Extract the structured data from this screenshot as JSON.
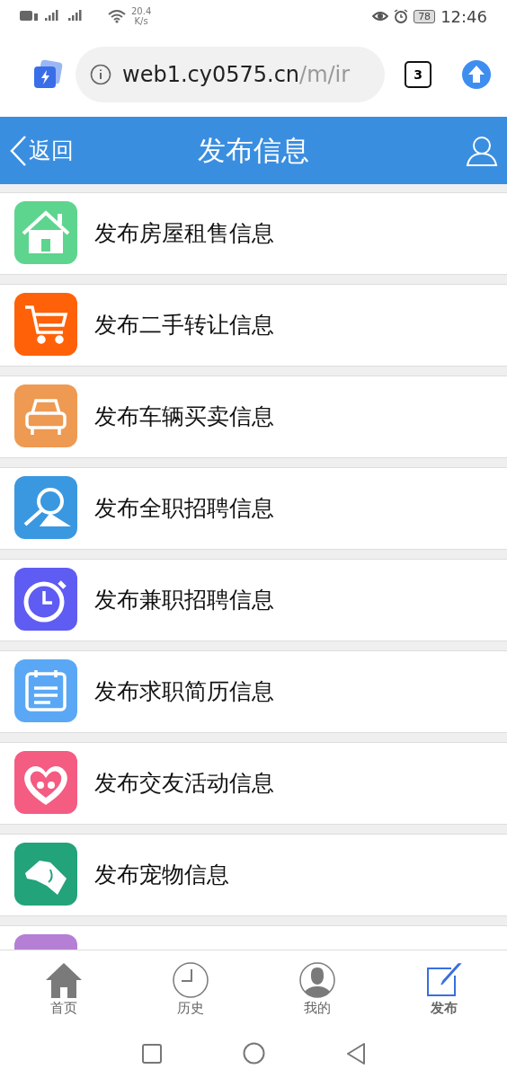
{
  "status_bar": {
    "network_speed": "20.4",
    "network_speed_unit": "K/s",
    "battery": "78",
    "time": "12:46"
  },
  "browser": {
    "url_host": "web1.cy0575.cn",
    "url_path": "/m/ir",
    "tab_count": "3"
  },
  "header": {
    "back_label": "返回",
    "title": "发布信息"
  },
  "items": [
    {
      "kind": "house",
      "label": "发布房屋租售信息",
      "color": "#5dd58e"
    },
    {
      "kind": "cart",
      "label": "发布二手转让信息",
      "color": "#ff6108"
    },
    {
      "kind": "car",
      "label": "发布车辆买卖信息",
      "color": "#ee9a52"
    },
    {
      "kind": "search",
      "label": "发布全职招聘信息",
      "color": "#3a98e0"
    },
    {
      "kind": "stopwatch",
      "label": "发布兼职招聘信息",
      "color": "#5e5cf2"
    },
    {
      "kind": "calendar",
      "label": "发布求职简历信息",
      "color": "#5aa8f5"
    },
    {
      "kind": "heart",
      "label": "发布交友活动信息",
      "color": "#f45c82"
    },
    {
      "kind": "dog",
      "label": "发布宠物信息",
      "color": "#22a37a"
    },
    {
      "kind": "blank",
      "color": "#b57fd6"
    }
  ],
  "tab_bar": [
    {
      "kind": "home",
      "label": "首页",
      "selected": false
    },
    {
      "kind": "history",
      "label": "历史",
      "selected": false
    },
    {
      "kind": "mine",
      "label": "我的",
      "selected": false
    },
    {
      "kind": "publish",
      "label": "发布",
      "selected": true
    }
  ]
}
